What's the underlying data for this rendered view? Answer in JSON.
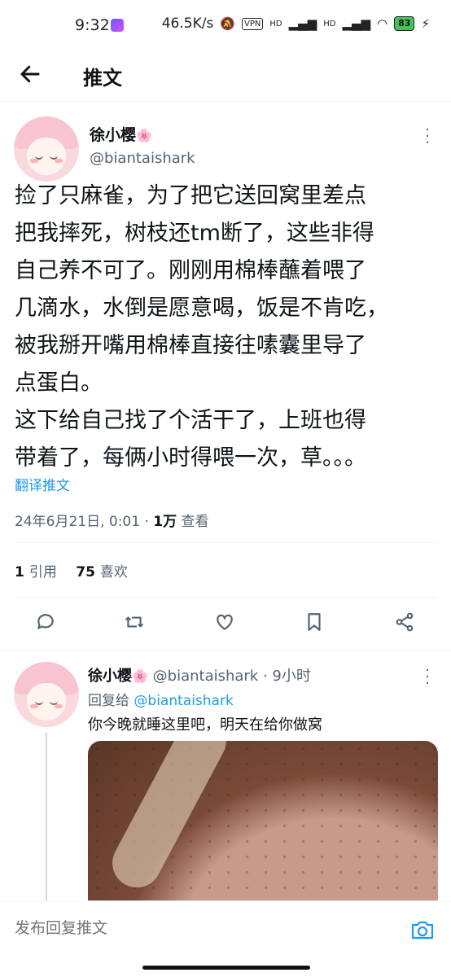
{
  "status_bar": {
    "time": "9:32",
    "network_speed": "46.5K/s",
    "vpn": "VPN",
    "signal1": "HD",
    "signal2": "HD",
    "battery": "83"
  },
  "header": {
    "title": "推文"
  },
  "tweet": {
    "author_name": "徐小樱",
    "author_emoji": "🌸",
    "handle": "@biantaishark",
    "text": "捡了只麻雀，为了把它送回窝里差点\n把我摔死，树枝还tm断了，这些非得\n自己养不可了。刚刚用棉棒蘸着喂了\n几滴水，水倒是愿意喝，饭是不肯吃，\n被我掰开嘴用棉棒直接往嗉囊里导了\n点蛋白。\n这下给自己找了个活干了，上班也得\n带着了，每俩小时得喂一次，草。。。",
    "translate_label": "翻译推文",
    "timestamp": "24年6月21日, 0:01",
    "separator": " · ",
    "views_count": "1万",
    "views_label": " 查看",
    "quotes_count": "1",
    "quotes_label": "引用",
    "likes_count": "75",
    "likes_label": "喜欢"
  },
  "reply": {
    "author_name": "徐小樱",
    "author_emoji": "🌸",
    "handle_time": " @biantaishark · 9小时",
    "reply_to_label": "回复给 ",
    "reply_to_handle": "@biantaishark",
    "text": "你今晚就睡这里吧，明天在给你做窝"
  },
  "compose": {
    "placeholder": "发布回复推文"
  }
}
